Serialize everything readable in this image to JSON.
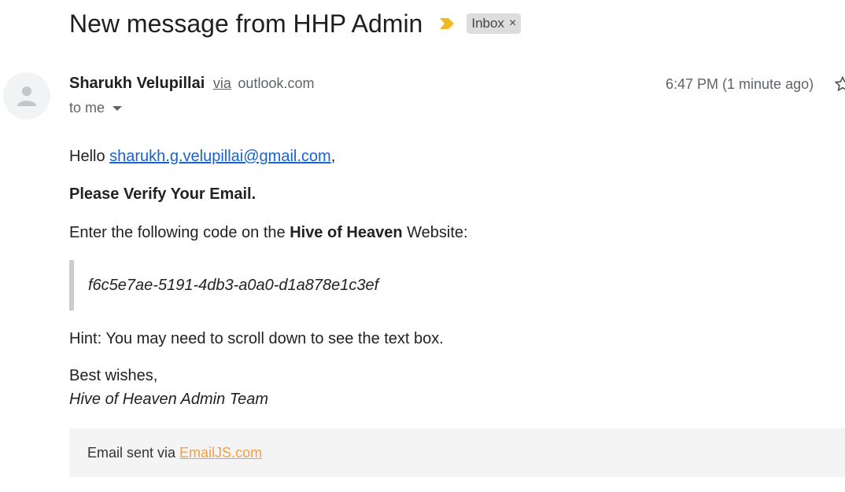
{
  "header": {
    "subject": "New message from HHP Admin",
    "label": "Inbox",
    "label_close": "×",
    "importance_color": "#f2b824"
  },
  "sender": {
    "name": "Sharukh Velupillai",
    "via": "via",
    "domain": "outlook.com",
    "to": "to me",
    "timestamp": "6:47 PM (1 minute ago)"
  },
  "message": {
    "greeting_prefix": "Hello ",
    "email_link": "sharukh.g.velupillai@gmail.com",
    "greeting_suffix": ",",
    "heading": "Please Verify Your Email.",
    "instruction_prefix": "Enter the following code on the ",
    "site_name": "Hive of Heaven",
    "instruction_suffix": " Website:",
    "code": "f6c5e7ae-5191-4db3-a0a0-d1a878e1c3ef",
    "hint": "Hint: You may need to scroll down to see the text box.",
    "signoff": "Best wishes,",
    "signature": "Hive of Heaven Admin Team"
  },
  "footer": {
    "text": "Email sent via ",
    "link": "EmailJS.com",
    "link_color": "#f0a04b"
  },
  "icons": {
    "importance": "importance-marker-icon",
    "avatar": "person-icon",
    "dropdown": "chevron-down-icon",
    "star": "star-icon"
  }
}
